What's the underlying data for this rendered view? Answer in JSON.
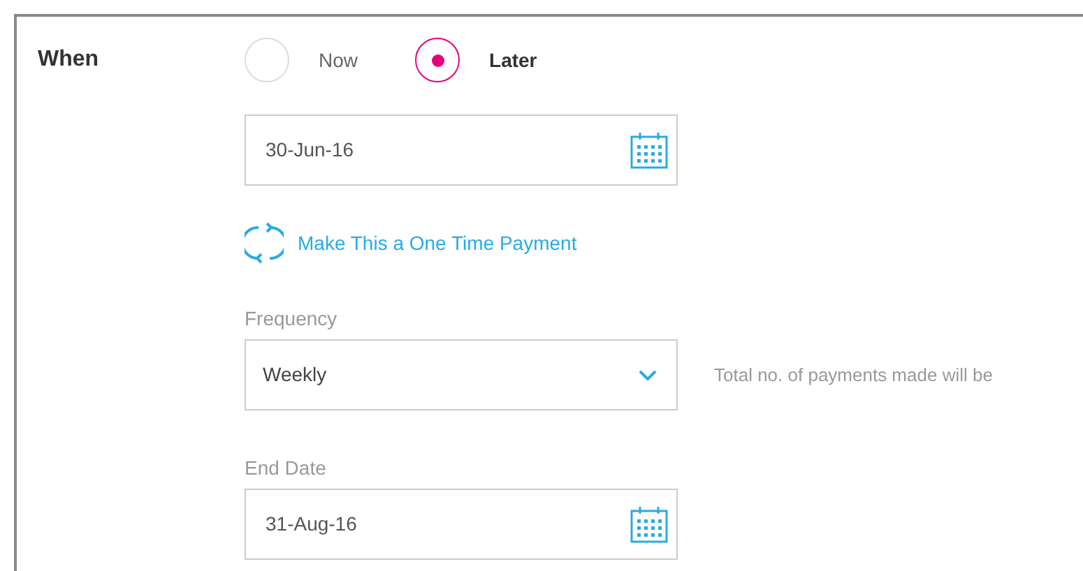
{
  "section_label": "When",
  "timing_options": [
    {
      "label": "Now",
      "selected": false
    },
    {
      "label": "Later",
      "selected": true
    }
  ],
  "start_date": {
    "value": "30-Jun-16"
  },
  "one_time_link": "Make This a One Time Payment",
  "frequency": {
    "label": "Frequency",
    "value": "Weekly",
    "note": "Total no. of payments made will be"
  },
  "end_date": {
    "label": "End Date",
    "value": "31-Aug-16"
  }
}
